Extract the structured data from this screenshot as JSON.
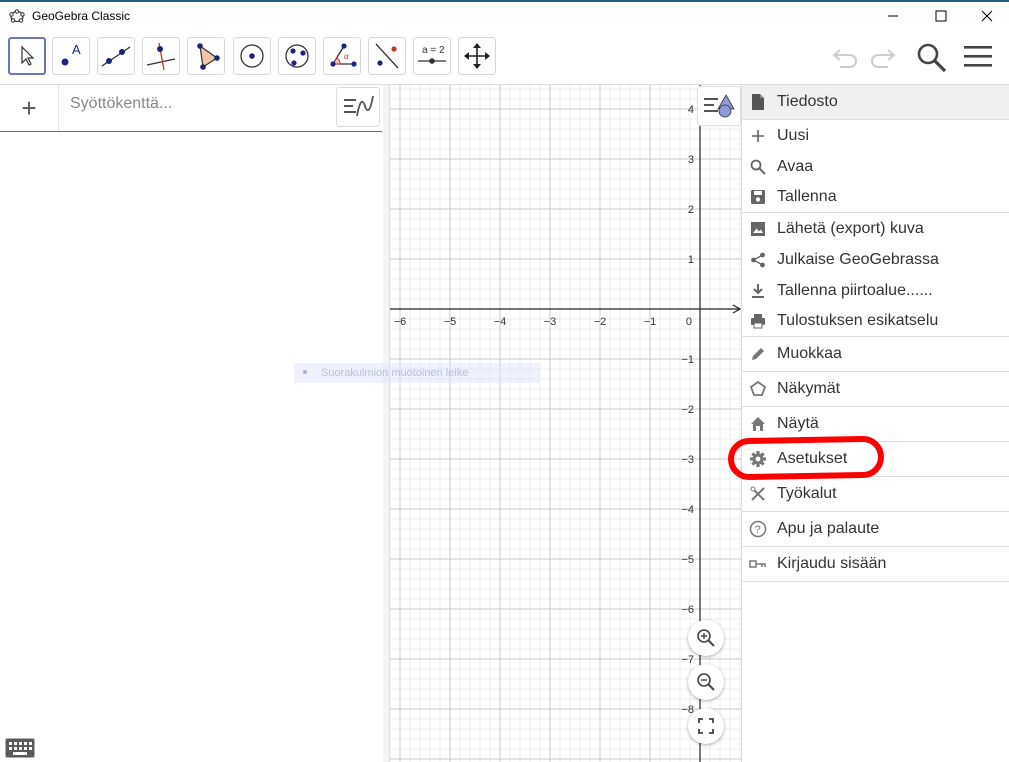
{
  "window": {
    "title": "GeoGebra Classic"
  },
  "toolbar": {
    "tools": [
      {
        "name": "move-tool"
      },
      {
        "name": "point-tool"
      },
      {
        "name": "line-tool"
      },
      {
        "name": "perpendicular-line-tool"
      },
      {
        "name": "polygon-tool"
      },
      {
        "name": "circle-center-point-tool"
      },
      {
        "name": "circle-three-points-tool"
      },
      {
        "name": "angle-tool"
      },
      {
        "name": "reflect-tool"
      },
      {
        "name": "slider-tool"
      },
      {
        "name": "move-graphics-view-tool"
      }
    ],
    "slider_label": "a = 2"
  },
  "algebra": {
    "input_placeholder": "Syöttökenttä..."
  },
  "graphics": {
    "x_labels": [
      "−6",
      "−5",
      "−4",
      "−3",
      "−2",
      "−1"
    ],
    "origin_label": "0",
    "y_labels_pos": [
      "4",
      "3",
      "2",
      "1"
    ],
    "y_labels_neg": [
      "−1",
      "−2",
      "−3",
      "−4",
      "−5",
      "−6",
      "−7",
      "−8"
    ],
    "tooltip": "Suorakulmion muotoinen leike"
  },
  "menu": {
    "header": "Tiedosto",
    "file_items": {
      "new": "Uusi",
      "open": "Avaa",
      "save": "Tallenna",
      "export_image": "Lähetä (export) kuva",
      "share": "Julkaise GeoGebrassa",
      "download": "Tallenna piirtoalue......",
      "print_preview": "Tulostuksen esikatselu"
    },
    "items": {
      "edit": "Muokkaa",
      "perspectives": "Näkymät",
      "view": "Näytä",
      "settings": "Asetukset",
      "tools": "Työkalut",
      "help": "Apu ja palaute",
      "sign_in": "Kirjaudu sisään"
    }
  },
  "colors": {
    "highlight": "#ff0000",
    "accent": "#6a76c4",
    "point": "#1a237e"
  }
}
